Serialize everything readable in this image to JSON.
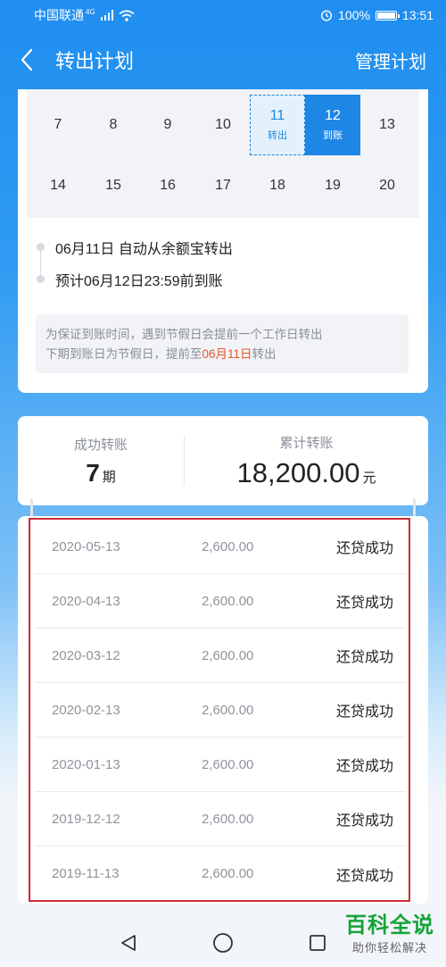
{
  "status_bar": {
    "carrier": "中国联通",
    "network": "4G",
    "battery": "100%",
    "time": "13:51"
  },
  "nav": {
    "title": "转出计划",
    "manage_label": "管理计划"
  },
  "calendar": {
    "rows": [
      [
        {
          "day": "7",
          "sub": ""
        },
        {
          "day": "8",
          "sub": ""
        },
        {
          "day": "9",
          "sub": ""
        },
        {
          "day": "10",
          "sub": ""
        },
        {
          "day": "11",
          "sub": "转出",
          "state": "transfer-out"
        },
        {
          "day": "12",
          "sub": "到账",
          "state": "arrival"
        },
        {
          "day": "13",
          "sub": ""
        }
      ],
      [
        {
          "day": "14",
          "sub": ""
        },
        {
          "day": "15",
          "sub": ""
        },
        {
          "day": "16",
          "sub": ""
        },
        {
          "day": "17",
          "sub": ""
        },
        {
          "day": "18",
          "sub": ""
        },
        {
          "day": "19",
          "sub": ""
        },
        {
          "day": "20",
          "sub": ""
        }
      ]
    ]
  },
  "timeline": {
    "step1": "06月11日 自动从余额宝转出",
    "step2": "预计06月12日23:59前到账"
  },
  "notice": {
    "line1": "为保证到账时间，遇到节假日会提前一个工作日转出",
    "line2_prefix": "下期到账日为节假日，提前至",
    "line2_highlight": "06月11日",
    "line2_suffix": "转出"
  },
  "summary": {
    "success_label": "成功转账",
    "success_count": "7",
    "success_unit": "期",
    "total_label": "累计转账",
    "total_amount": "18,200.00",
    "total_unit": "元"
  },
  "records": [
    {
      "date": "2020-05-13",
      "amount": "2,600.00",
      "status": "还贷成功"
    },
    {
      "date": "2020-04-13",
      "amount": "2,600.00",
      "status": "还贷成功"
    },
    {
      "date": "2020-03-12",
      "amount": "2,600.00",
      "status": "还贷成功"
    },
    {
      "date": "2020-02-13",
      "amount": "2,600.00",
      "status": "还贷成功"
    },
    {
      "date": "2020-01-13",
      "amount": "2,600.00",
      "status": "还贷成功"
    },
    {
      "date": "2019-12-12",
      "amount": "2,600.00",
      "status": "还贷成功"
    },
    {
      "date": "2019-11-13",
      "amount": "2,600.00",
      "status": "还贷成功"
    }
  ],
  "watermark": {
    "title": "百科全说",
    "subtitle": "助你轻松解决"
  },
  "colors": {
    "accent": "#1e87e6",
    "highlight": "#e4572e",
    "annotation": "#cc2a36",
    "watermark": "#17a339"
  }
}
